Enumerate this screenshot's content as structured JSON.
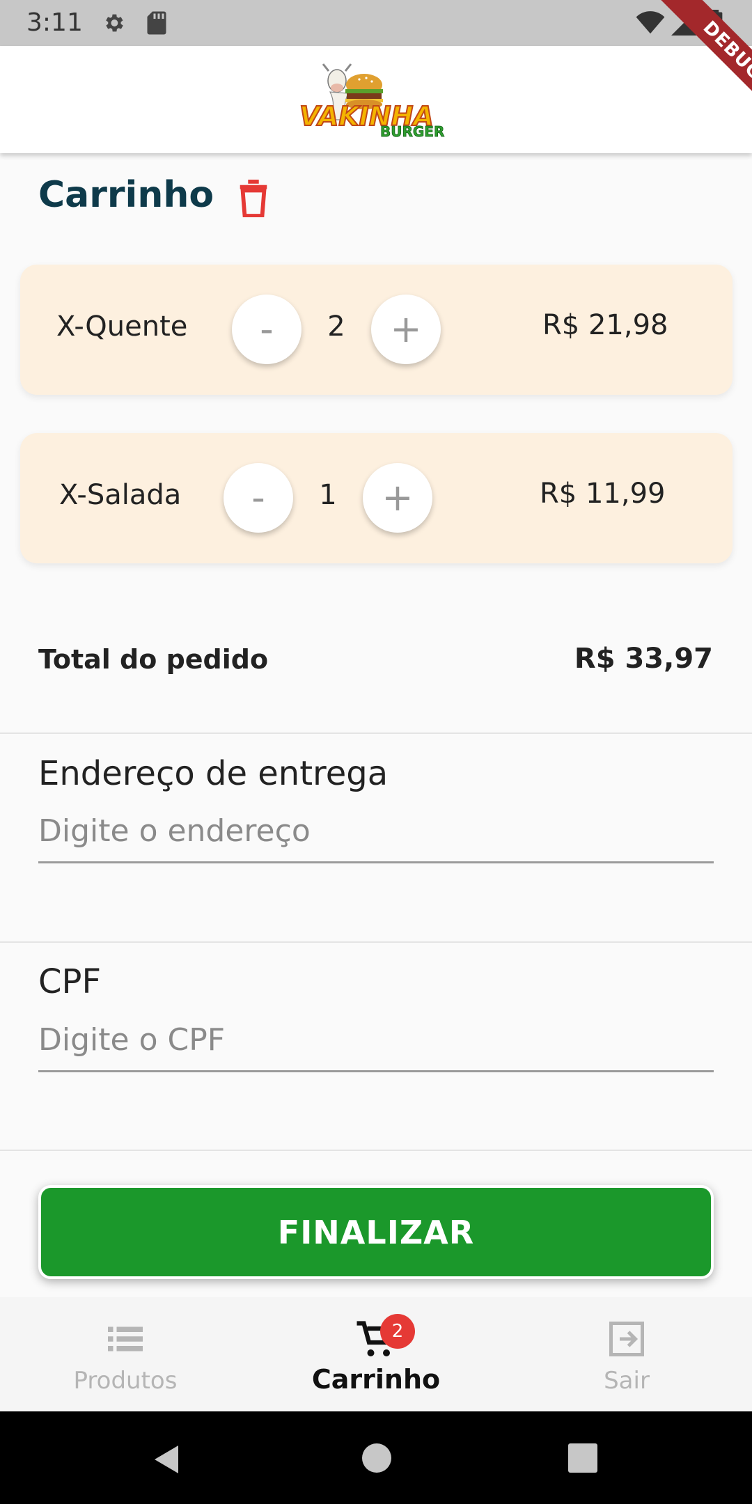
{
  "status_bar": {
    "time": "3:11",
    "icons": [
      "gear-icon",
      "sd-card-icon",
      "wifi-icon",
      "signal-icon",
      "battery-icon"
    ]
  },
  "debug_banner": "DEBUG",
  "app_bar": {
    "logo_text": "VAKINHA BURGER"
  },
  "cart": {
    "title": "Carrinho",
    "items": [
      {
        "name": "X-Quente",
        "quantity": "2",
        "price": "R$ 21,98",
        "decrement": "-",
        "increment": "+"
      },
      {
        "name": "X-Salada",
        "quantity": "1",
        "price": "R$ 11,99",
        "decrement": "-",
        "increment": "+"
      }
    ],
    "total_label": "Total do pedido",
    "total_value": "R$ 33,97"
  },
  "form": {
    "address_label": "Endereço de entrega",
    "address_placeholder": "Digite o endereço",
    "address_value": "",
    "cpf_label": "CPF",
    "cpf_placeholder": "Digite o CPF",
    "cpf_value": ""
  },
  "finalize_label": "FINALIZAR",
  "bottom_nav": {
    "items": [
      {
        "label": "Produtos",
        "icon": "list-icon",
        "active": false
      },
      {
        "label": "Carrinho",
        "icon": "cart-icon",
        "active": true,
        "badge": "2"
      },
      {
        "label": "Sair",
        "icon": "exit-icon",
        "active": false
      }
    ]
  },
  "colors": {
    "brand_green": "#1b982b",
    "card_bg": "#fdf0df",
    "title": "#0e3a4a",
    "danger": "#e53935",
    "debug": "#a3282b"
  }
}
